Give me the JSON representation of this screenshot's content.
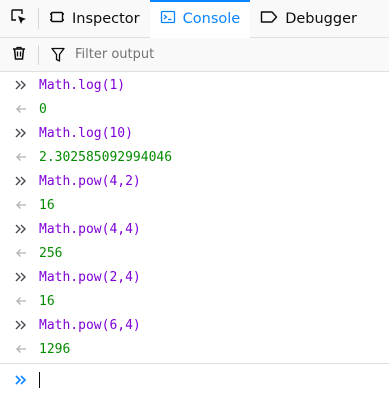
{
  "tabs": [
    {
      "label": "Inspector",
      "icon": "inspector-icon",
      "active": false
    },
    {
      "label": "Console",
      "icon": "console-icon",
      "active": true
    },
    {
      "label": "Debugger",
      "icon": "debugger-icon",
      "active": false
    }
  ],
  "filter": {
    "placeholder": "Filter output",
    "value": ""
  },
  "colors": {
    "accent": "#0a84ff",
    "command": "#8000d7",
    "result": "#058b00"
  },
  "output": [
    {
      "type": "command",
      "text": "Math.log(1)"
    },
    {
      "type": "result",
      "text": "0"
    },
    {
      "type": "command",
      "text": "Math.log(10)"
    },
    {
      "type": "result",
      "text": "2.302585092994046"
    },
    {
      "type": "command",
      "text": "Math.pow(4,2)"
    },
    {
      "type": "result",
      "text": "16"
    },
    {
      "type": "command",
      "text": "Math.pow(4,4)"
    },
    {
      "type": "result",
      "text": "256"
    },
    {
      "type": "command",
      "text": "Math.pow(2,4)"
    },
    {
      "type": "result",
      "text": "16"
    },
    {
      "type": "command",
      "text": "Math.pow(6,4)"
    },
    {
      "type": "result",
      "text": "1296"
    }
  ],
  "input": {
    "value": ""
  }
}
